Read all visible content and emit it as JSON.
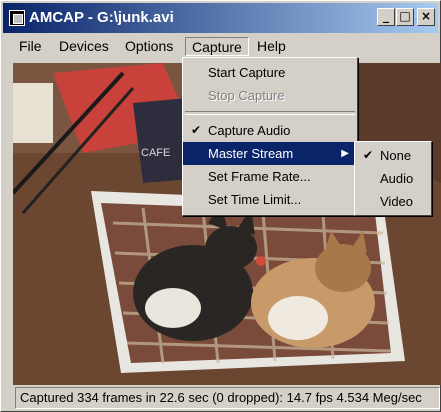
{
  "window": {
    "title": "AMCAP - G:\\junk.avi"
  },
  "title_buttons": {
    "minimize": "_",
    "maximize": "□",
    "close": "×"
  },
  "menubar": {
    "file": "File",
    "devices": "Devices",
    "options": "Options",
    "capture": "Capture",
    "help": "Help"
  },
  "capture_menu": {
    "start": "Start Capture",
    "stop": "Stop Capture",
    "audio": "Capture Audio",
    "master": "Master Stream",
    "frame_rate": "Set Frame Rate...",
    "time_limit": "Set Time Limit..."
  },
  "submenu": {
    "none": "None",
    "audio": "Audio",
    "video": "Video"
  },
  "glyphs": {
    "check": "✔",
    "arrow": "▶"
  },
  "video": {
    "caption_word": "CAFE"
  },
  "status": {
    "text": "Captured 334 frames in 22.6 sec (0 dropped): 14.7 fps 4.534 Meg/sec"
  },
  "colors": {
    "titlebar": "#0a246a",
    "menu_highlight": "#0a246a",
    "face": "#d4d0c8"
  }
}
